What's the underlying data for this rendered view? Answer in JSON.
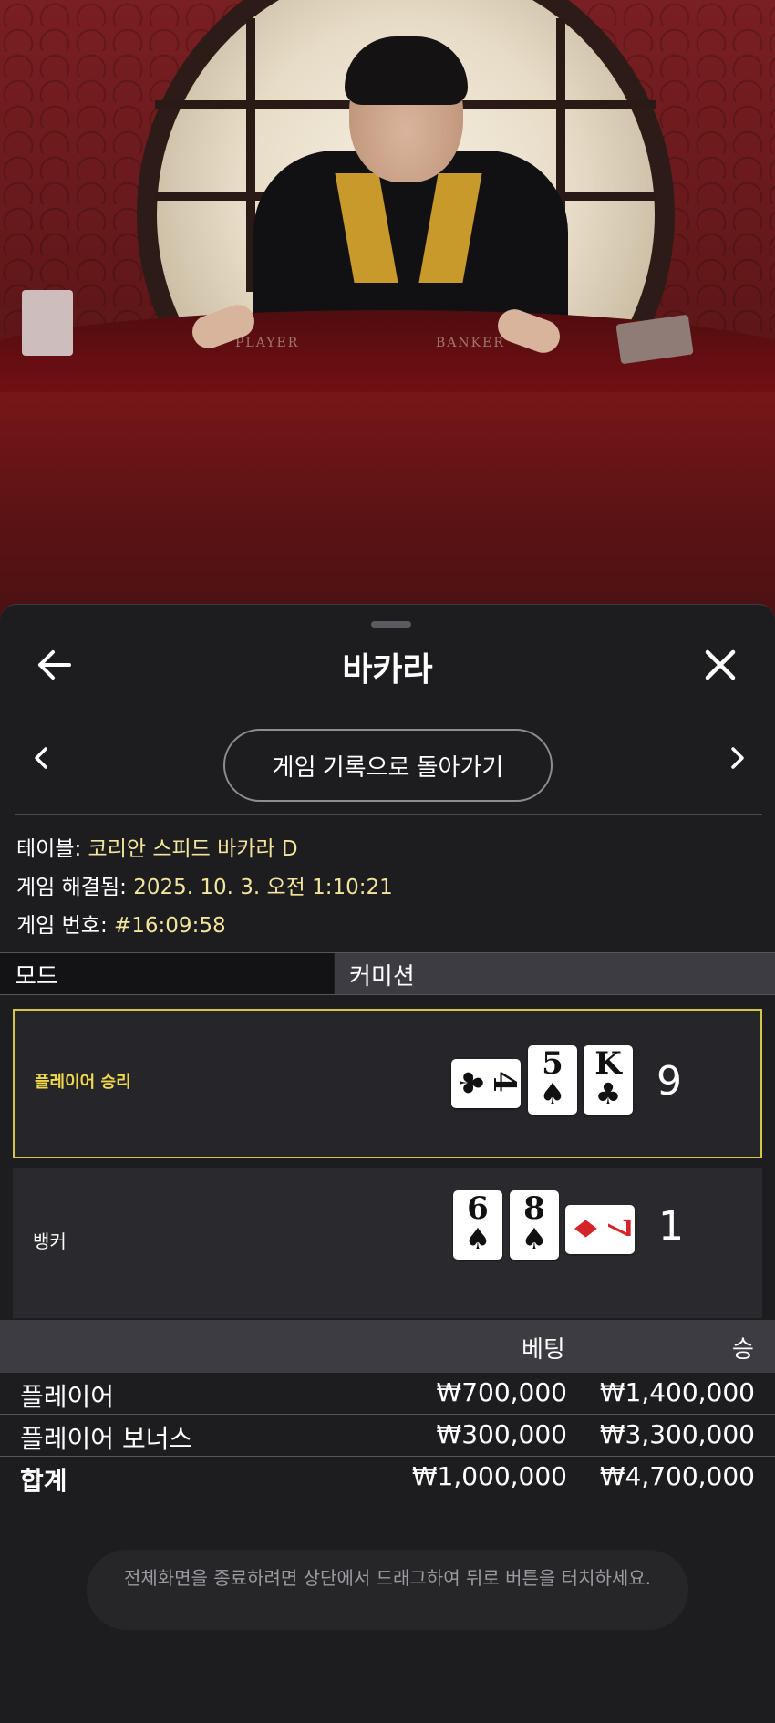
{
  "header": {
    "title": "바카라"
  },
  "nav": {
    "history_button_label": "게임 기록으로 돌아가기"
  },
  "info": {
    "table_label": "테이블:",
    "table_value": "코리안 스피드 바카라 D",
    "resolved_label": "게임 해결됨:",
    "resolved_value": "2025. 10. 3. 오전 1:10:21",
    "game_number_label": "게임 번호:",
    "game_number_value": "#16:09:58"
  },
  "mode": {
    "label": "모드",
    "value": "커미션"
  },
  "results": {
    "player": {
      "label": "플레이어 승리",
      "score": "9",
      "cards": [
        {
          "rank": "4",
          "suit": "♣",
          "orientation": "horizontal",
          "color": "#111111"
        },
        {
          "rank": "5",
          "suit": "♠",
          "orientation": "vertical",
          "color": "#111111"
        },
        {
          "rank": "K",
          "suit": "♣",
          "orientation": "vertical",
          "color": "#111111"
        }
      ]
    },
    "banker": {
      "label": "뱅커",
      "score": "1",
      "cards": [
        {
          "rank": "6",
          "suit": "♠",
          "orientation": "vertical",
          "color": "#111111"
        },
        {
          "rank": "8",
          "suit": "♠",
          "orientation": "vertical",
          "color": "#111111"
        },
        {
          "rank": "7",
          "suit": "♦",
          "orientation": "horizontal",
          "color": "#d62229"
        }
      ]
    }
  },
  "bets": {
    "columns": {
      "bet": "베팅",
      "win": "승"
    },
    "rows": [
      {
        "name": "플레이어",
        "bet": "₩700,000",
        "win": "₩1,400,000"
      },
      {
        "name": "플레이어 보너스",
        "bet": "₩300,000",
        "win": "₩3,300,000"
      }
    ],
    "total": {
      "name": "합계",
      "bet": "₩1,000,000",
      "win": "₩4,700,000"
    }
  },
  "toast": {
    "message": "전체화면을 종료하려면 상단에서 드래그하여 뒤로 버튼을 터치하세요."
  },
  "video": {
    "table_text_player": "PLAYER",
    "table_text_banker": "BANKER"
  },
  "colors": {
    "accent_yellow": "#f0d84a",
    "info_value": "#f3e59b",
    "sheet_bg": "#1d1d20",
    "felt_red": "#6b1a1c"
  }
}
